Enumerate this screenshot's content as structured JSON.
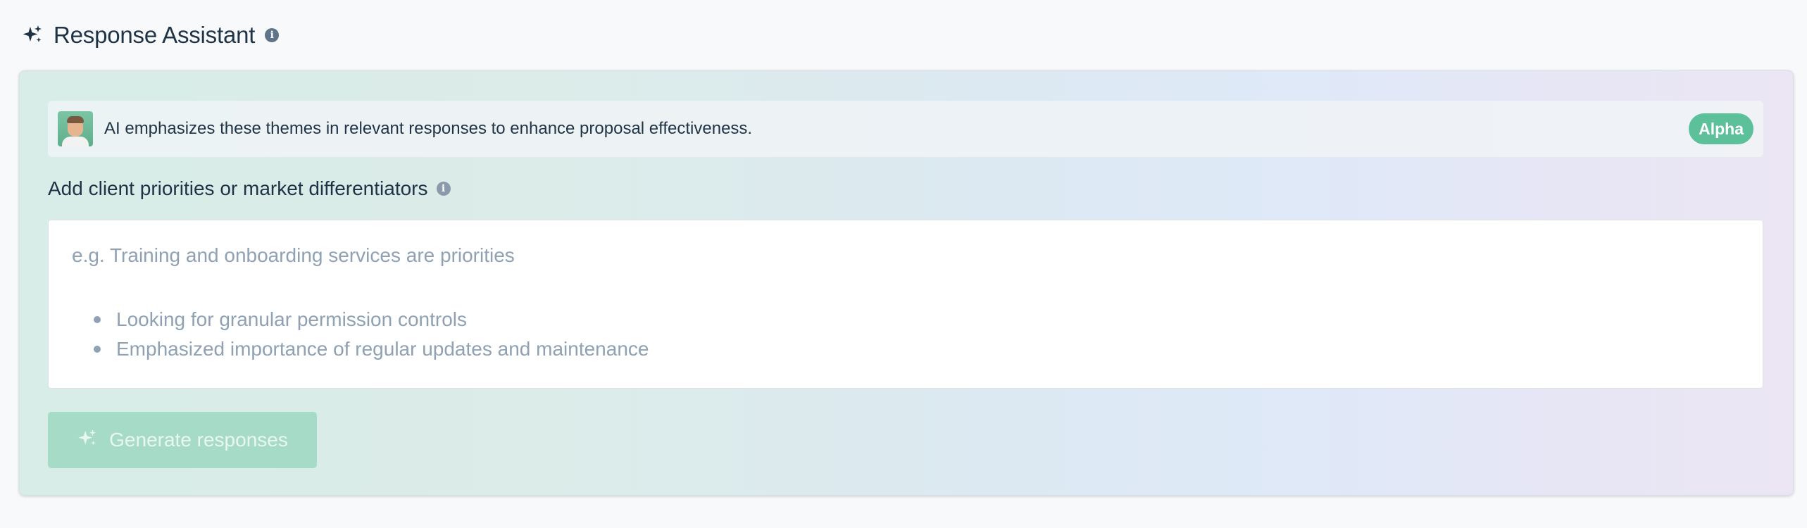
{
  "header": {
    "title": "Response Assistant",
    "icon": "sparkle-icon",
    "info_icon": "info-icon"
  },
  "notice": {
    "avatar": "avatar",
    "text": "AI emphasizes these themes in relevant responses to enhance proposal effectiveness.",
    "badge": "Alpha"
  },
  "field": {
    "label": "Add client priorities or market differentiators",
    "info_icon": "info-icon",
    "placeholder_line": "e.g. Training and onboarding services are priorities",
    "placeholder_bullets": [
      "Looking for granular permission controls",
      "Emphasized importance of regular updates and maintenance"
    ]
  },
  "button": {
    "label": "Generate responses",
    "icon": "sparkle-icon",
    "enabled": false
  },
  "colors": {
    "accent": "#5cc19a",
    "button_disabled_bg": "#a6dcc7",
    "text_primary": "#1f3347",
    "placeholder": "#8fa1b3"
  }
}
